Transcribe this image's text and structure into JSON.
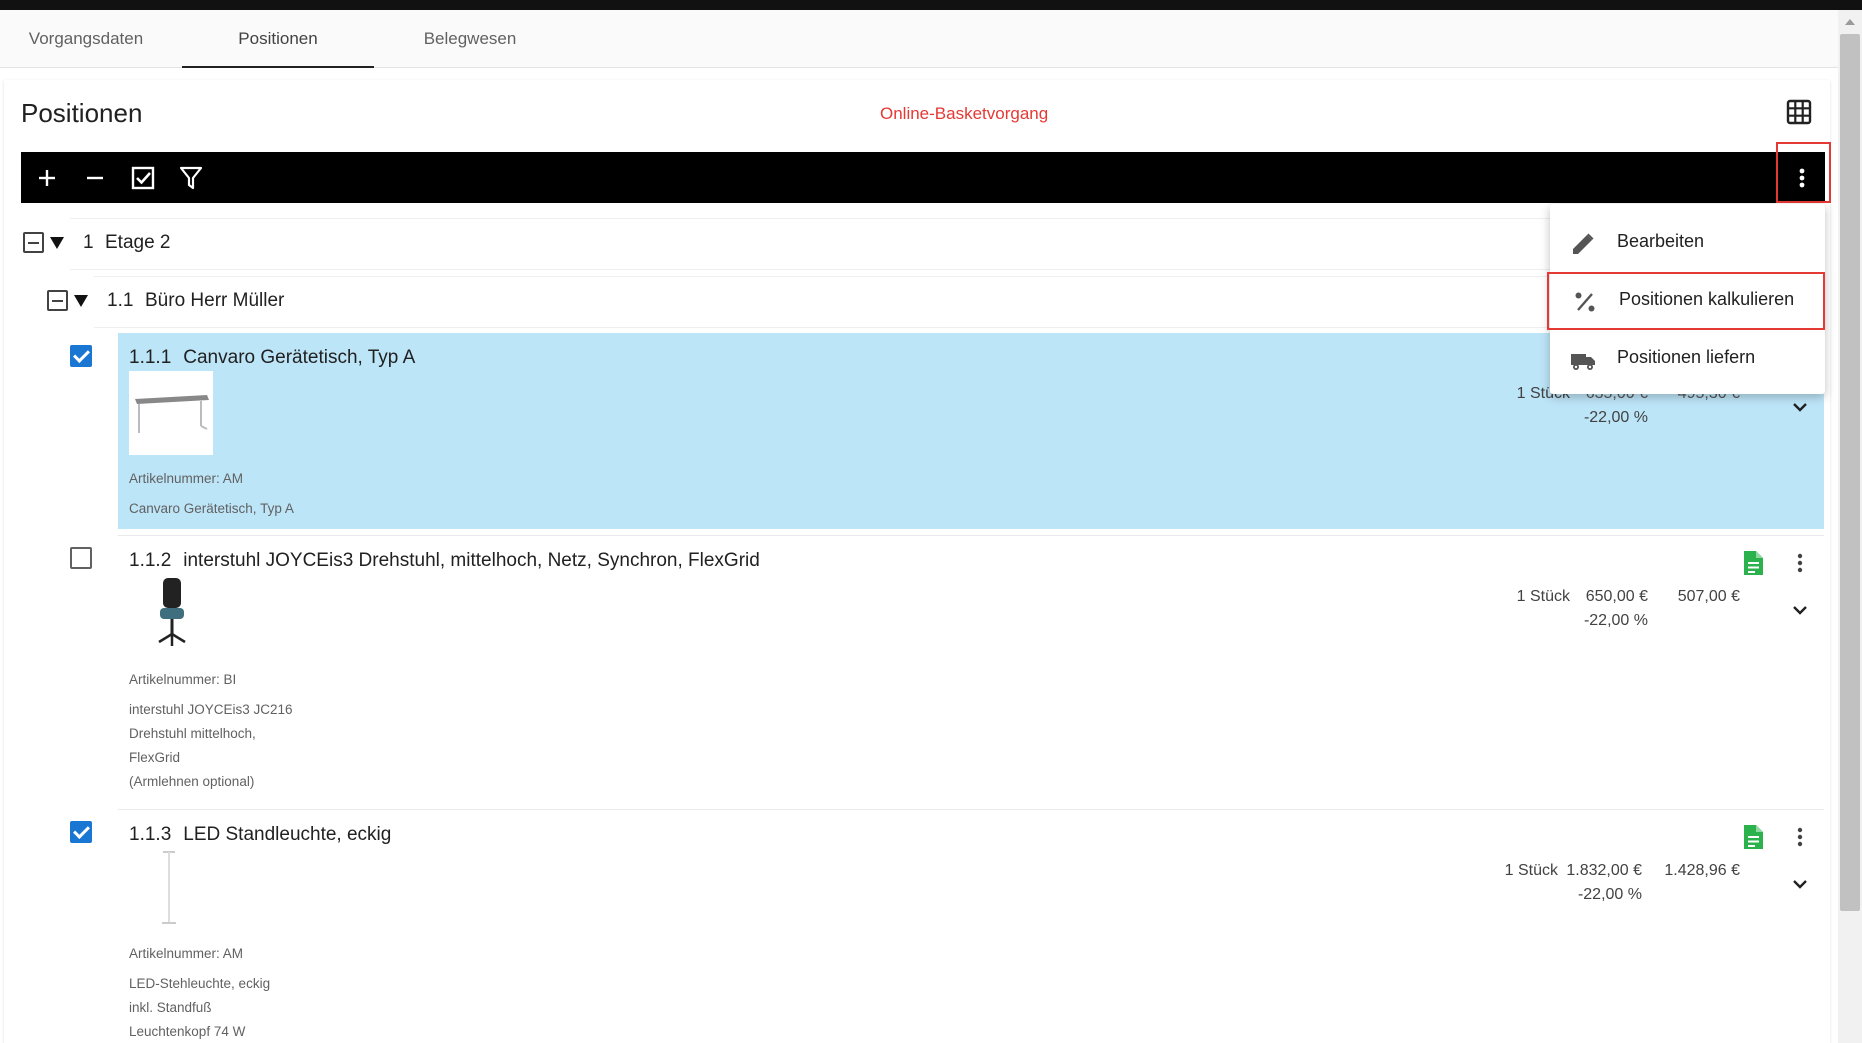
{
  "tabs": [
    {
      "label": "Vorgangsdaten",
      "active": false
    },
    {
      "label": "Positionen",
      "active": true
    },
    {
      "label": "Belegwesen",
      "active": false
    }
  ],
  "header": {
    "title": "Positionen",
    "status": "Online-Basketvorgang"
  },
  "toolbar": {
    "icons": [
      "plus-icon",
      "minus-icon",
      "checklist-icon",
      "filter-icon",
      "more-vert-icon"
    ]
  },
  "groups": [
    {
      "number": "1",
      "label": "Etage 2"
    },
    {
      "number": "1.1",
      "label": "Büro Herr Müller"
    }
  ],
  "items": [
    {
      "number": "1.1.1",
      "title": "Canvaro Gerätetisch, Typ A",
      "checked": true,
      "quantity": "1 Stück",
      "price": "635,00 €",
      "discount": "-22,00 %",
      "total": "495,30 €",
      "article_number": "Artikelnummer: AM",
      "description": [
        "Canvaro Gerätetisch, Typ A"
      ]
    },
    {
      "number": "1.1.2",
      "title": "interstuhl JOYCEis3 Drehstuhl, mittelhoch, Netz, Synchron, FlexGrid",
      "checked": false,
      "quantity": "1 Stück",
      "price": "650,00 €",
      "discount": "-22,00 %",
      "total": "507,00 €",
      "article_number": "Artikelnummer: BI",
      "description": [
        "interstuhl JOYCEis3 JC216",
        "Drehstuhl mittelhoch,",
        "FlexGrid",
        "(Armlehnen optional)"
      ]
    },
    {
      "number": "1.1.3",
      "title": "LED Standleuchte, eckig",
      "checked": true,
      "quantity": "1 Stück",
      "price": "1.832,00 €",
      "discount": "-22,00 %",
      "total": "1.428,96 €",
      "article_number": "Artikelnummer: AM",
      "description": [
        "LED-Stehleuchte, eckig",
        "inkl. Standfuß",
        "Leuchtenkopf 74 W"
      ]
    }
  ],
  "context_menu": {
    "items": [
      {
        "label": "Bearbeiten",
        "icon": "pencil-icon"
      },
      {
        "label": "Positionen kalkulieren",
        "icon": "percent-icon"
      },
      {
        "label": "Positionen liefern",
        "icon": "truck-icon"
      }
    ]
  },
  "colors": {
    "selected_row": "#bde5f8",
    "checkbox": "#1976d2",
    "status_text": "#e53935",
    "doc_icon": "#2bb24c",
    "highlight_border": "#e53935"
  }
}
